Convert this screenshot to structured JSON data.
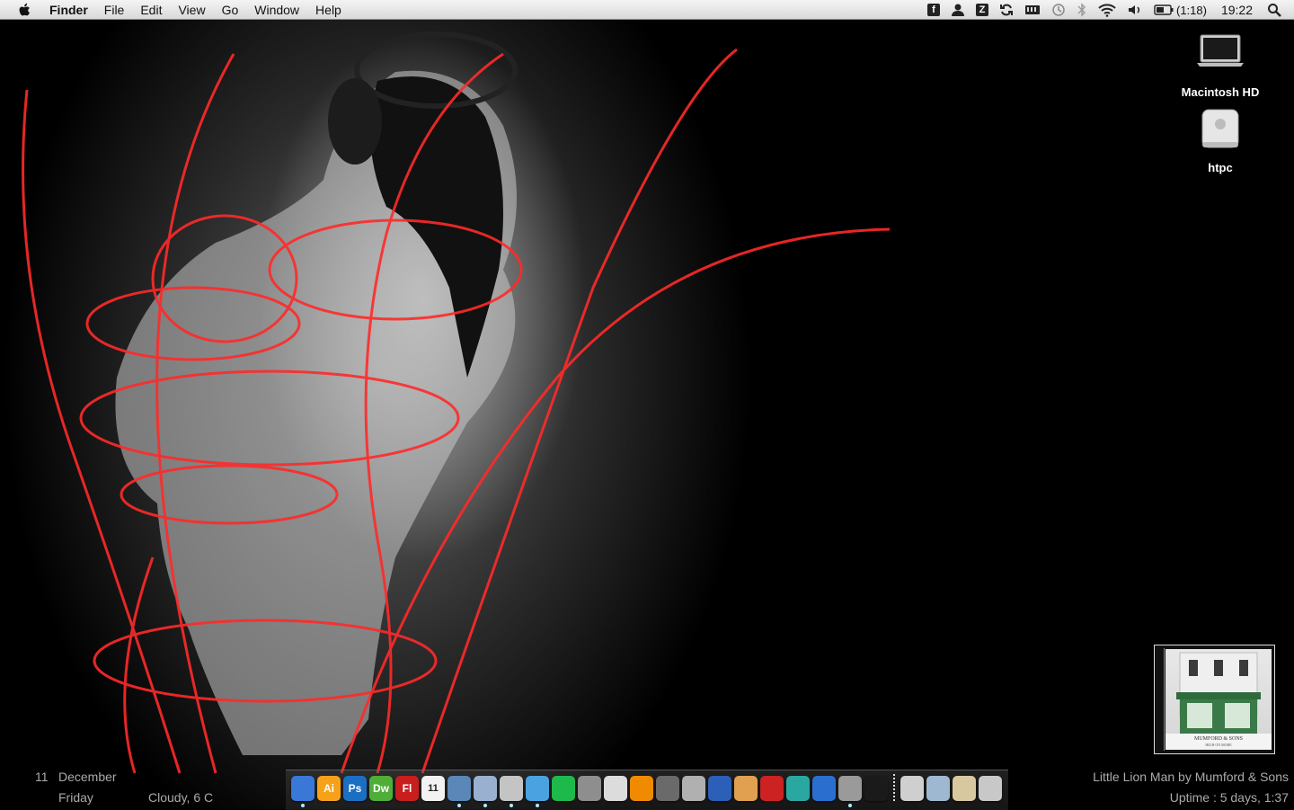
{
  "menubar": {
    "apple_icon": "apple-icon",
    "items": [
      {
        "label": "Finder",
        "app": true
      },
      {
        "label": "File"
      },
      {
        "label": "Edit"
      },
      {
        "label": "View"
      },
      {
        "label": "Go"
      },
      {
        "label": "Window"
      },
      {
        "label": "Help"
      }
    ],
    "status": {
      "battery_time": "(1:18)",
      "clock": "19:22"
    }
  },
  "desktop_icons": [
    {
      "label": "Macintosh HD",
      "icon": "laptop-drive-icon"
    },
    {
      "label": "htpc",
      "icon": "network-drive-icon"
    }
  ],
  "widgets": {
    "date_day": "11",
    "date_month": "December",
    "weekday": "Friday",
    "weather": "Cloudy, 6 C",
    "now_playing": "Little Lion Man by Mumford & Sons",
    "uptime": "Uptime : 5 days, 1:37",
    "album_cover_text_1": "MUMFORD & SONS",
    "album_cover_text_2": "HIGH ON MORE"
  },
  "dock": {
    "apps": [
      {
        "icon": "finder-icon",
        "label": "",
        "color": "#3a78d8",
        "running": true
      },
      {
        "icon": "illustrator-icon",
        "label": "Ai",
        "color": "#f7a11a"
      },
      {
        "icon": "photoshop-icon",
        "label": "Ps",
        "color": "#1b6fc2"
      },
      {
        "icon": "dreamweaver-icon",
        "label": "Dw",
        "color": "#4fae38"
      },
      {
        "icon": "flash-icon",
        "label": "Fl",
        "color": "#c81e1e"
      },
      {
        "icon": "calendar-icon",
        "label": "11",
        "color": "#f2f2f2"
      },
      {
        "icon": "safari-icon",
        "label": "",
        "color": "#5a86b8",
        "running": true
      },
      {
        "icon": "mail-icon",
        "label": "",
        "color": "#9ab0d0",
        "running": true
      },
      {
        "icon": "preview-icon",
        "label": "",
        "color": "#c4c4c4",
        "running": true
      },
      {
        "icon": "itunes-icon",
        "label": "",
        "color": "#4aa3e0",
        "running": true
      },
      {
        "icon": "spotify-icon",
        "label": "",
        "color": "#1db94a"
      },
      {
        "icon": "system-preferences-icon",
        "label": "",
        "color": "#8e8e8e"
      },
      {
        "icon": "textedit-icon",
        "label": "",
        "color": "#dcdcdc"
      },
      {
        "icon": "vlc-icon",
        "label": "",
        "color": "#f08a00"
      },
      {
        "icon": "script-editor-icon",
        "label": "",
        "color": "#6a6a6a"
      },
      {
        "icon": "cyberduck-icon",
        "label": "",
        "color": "#b0b0b0"
      },
      {
        "icon": "transmit-icon",
        "label": "",
        "color": "#2c5fb8"
      },
      {
        "icon": "iphoto-icon",
        "label": "",
        "color": "#e0a050"
      },
      {
        "icon": "photo-booth-icon",
        "label": "",
        "color": "#cc2222"
      },
      {
        "icon": "time-machine-icon",
        "label": "",
        "color": "#2aa7a0"
      },
      {
        "icon": "vmware-icon",
        "label": "",
        "color": "#2a6fd0"
      },
      {
        "icon": "automator-icon",
        "label": "",
        "color": "#9a9a9a",
        "running": true
      },
      {
        "icon": "activity-monitor-icon",
        "label": "",
        "color": "#1a1a1a"
      }
    ],
    "folders": [
      {
        "icon": "documents-folder-icon",
        "color": "#cfcfcf"
      },
      {
        "icon": "downloads-stack-icon",
        "color": "#9eb8d2"
      },
      {
        "icon": "applications-folder-icon",
        "color": "#d8c8a0"
      },
      {
        "icon": "trash-icon",
        "color": "#c8c8c8"
      }
    ]
  }
}
